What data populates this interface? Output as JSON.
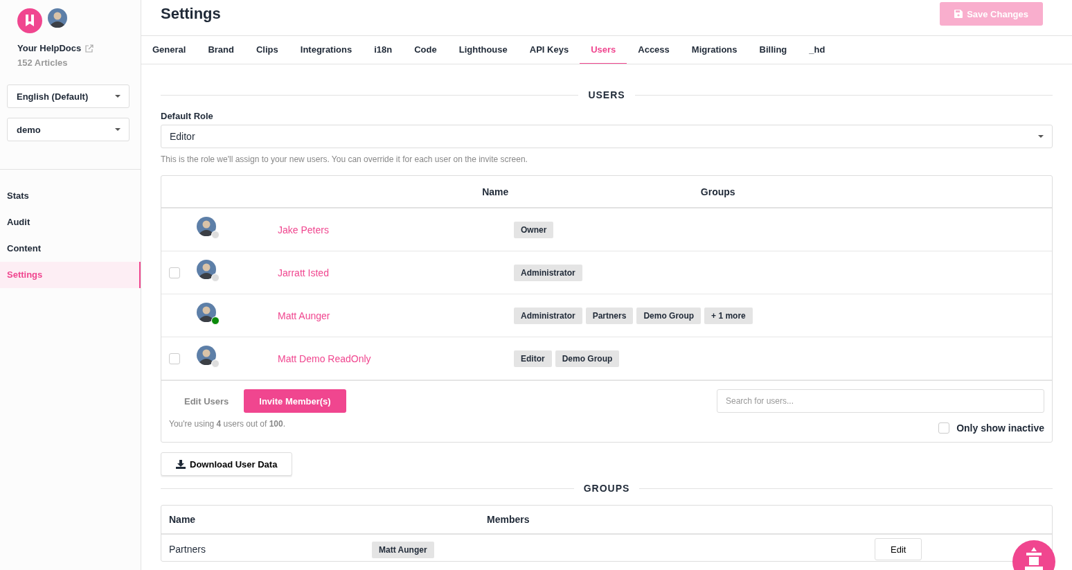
{
  "sidebar": {
    "site_name": "Your HelpDocs",
    "article_count": "152 Articles",
    "language_select": {
      "value": "English (Default)"
    },
    "workspace_select": {
      "value": "demo"
    },
    "items": [
      {
        "label": "Stats",
        "selected": false
      },
      {
        "label": "Audit",
        "selected": false
      },
      {
        "label": "Content",
        "selected": false
      },
      {
        "label": "Settings",
        "selected": true
      }
    ]
  },
  "header": {
    "title": "Settings",
    "save_button": {
      "label": "Save Changes",
      "disabled": true
    }
  },
  "tabs": [
    {
      "label": "General",
      "selected": false
    },
    {
      "label": "Brand",
      "selected": false
    },
    {
      "label": "Clips",
      "selected": false
    },
    {
      "label": "Integrations",
      "selected": false
    },
    {
      "label": "i18n",
      "selected": false
    },
    {
      "label": "Code",
      "selected": false
    },
    {
      "label": "Lighthouse",
      "selected": false
    },
    {
      "label": "API Keys",
      "selected": false
    },
    {
      "label": "Users",
      "selected": true
    },
    {
      "label": "Access",
      "selected": false
    },
    {
      "label": "Migrations",
      "selected": false
    },
    {
      "label": "Billing",
      "selected": false
    },
    {
      "label": "_hd",
      "selected": false
    }
  ],
  "users_section": {
    "heading": "USERS",
    "default_role": {
      "label": "Default Role",
      "value": "Editor",
      "help": "This is the role we'll assign to your new users. You can override it for each user on the invite screen."
    },
    "table": {
      "columns": [
        "Name",
        "Groups"
      ],
      "rows": [
        {
          "name": "Jake Peters",
          "online": false,
          "groups": [
            "Owner"
          ]
        },
        {
          "name": "Jarratt Isted",
          "online": false,
          "checked": false,
          "groups": [
            "Administrator"
          ]
        },
        {
          "name": "Matt Aunger",
          "online": true,
          "groups": [
            "Administrator",
            "Partners",
            "Demo Group",
            "+ 1 more"
          ]
        },
        {
          "name": "Matt Demo ReadOnly",
          "online": false,
          "checked": false,
          "groups": [
            "Editor",
            "Demo Group"
          ]
        }
      ]
    },
    "edit_users": "Edit Users",
    "invite_button": "Invite Member(s)",
    "usage": "You're using **4** users out of **100**.",
    "search": {
      "placeholder": "Search for users..."
    },
    "only_inactive": {
      "label": "Only show inactive",
      "checked": false
    },
    "download_button": "Download User Data"
  },
  "groups_section": {
    "heading": "GROUPS",
    "columns": [
      "Name",
      "Members"
    ],
    "rows": [
      {
        "name": "Partners",
        "members": [
          "Matt Aunger"
        ],
        "action": "Edit"
      }
    ]
  }
}
